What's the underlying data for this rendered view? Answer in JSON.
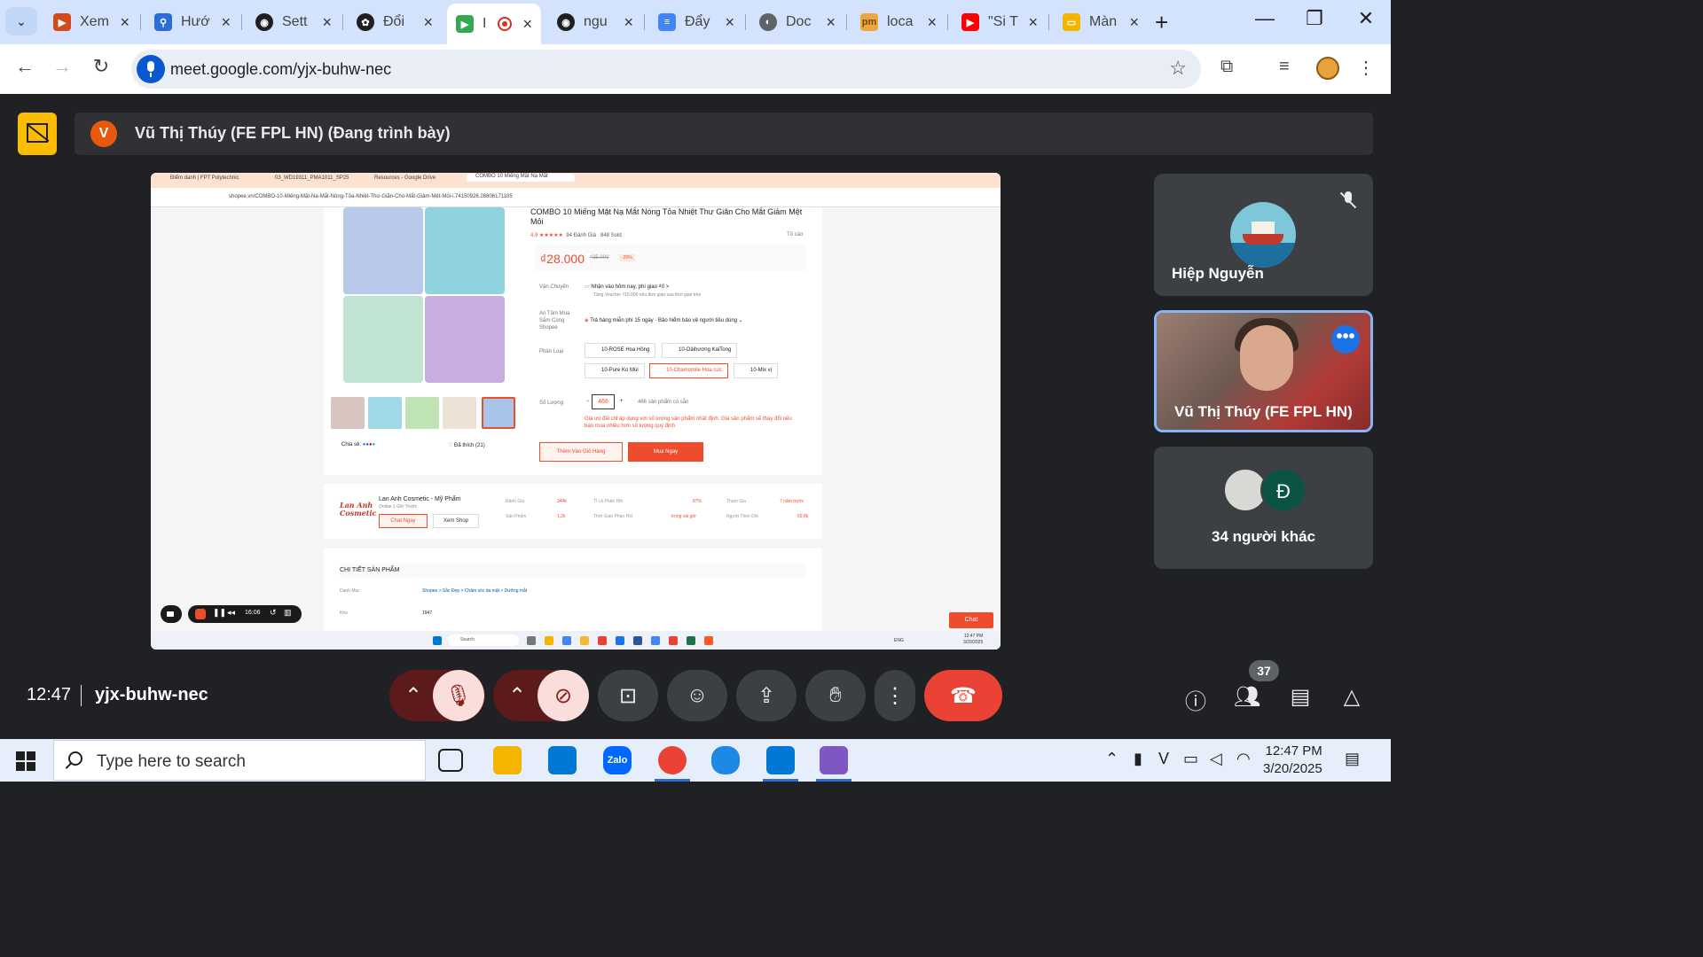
{
  "browser": {
    "tabs": [
      {
        "label": "Xem"
      },
      {
        "label": "Hướ"
      },
      {
        "label": "Sett"
      },
      {
        "label": "Đổi"
      },
      {
        "label": "I"
      },
      {
        "label": "ngu"
      },
      {
        "label": "Đẩy"
      },
      {
        "label": "Doc"
      },
      {
        "label": "loca"
      },
      {
        "label": "\"Si T"
      },
      {
        "label": "Màn"
      }
    ],
    "url": "meet.google.com/yjx-buhw-nec"
  },
  "meet": {
    "presenter_initial": "V",
    "presenter_banner": "Vũ Thị Thúy (FE FPL HN) (Đang trình bày)",
    "clock": "12:47",
    "meeting_code": "yjx-buhw-nec",
    "participants_count": "37",
    "tiles": {
      "t1_name": "Hiệp Nguyễn",
      "t2_name": "Vũ Thị Thúy (FE FPL HN)",
      "t3_name": "34 người khác",
      "t3_avatar_letter": "Đ"
    }
  },
  "shared": {
    "tabs": [
      "Điểm danh | FPT Polytechnic",
      "03_WD19311_PMA1011_SP25",
      "Resources - Google Drive",
      "COMBO 10 Miếng Mặt Nạ Mắt"
    ],
    "url": "shopee.vn/COMBO-10-Miếng-Mặt-Nạ-Mắt-Nóng-Tỏa-Nhiệt-Thư-Giãn-Cho-Mắt-Giảm-Mệt-Mỏi-i.74150926.28806171105",
    "product_title": "COMBO 10 Miếng Mặt Nạ Mắt Nóng Tỏa Nhiệt Thư Giãn Cho Mắt Giảm Mệt Mỏi",
    "rating": "4.9",
    "rating_count": "94",
    "rating_label": "Đánh Giá",
    "sold": "848",
    "sold_label": "Sold",
    "report": "Tố cáo",
    "price": "₫28.000",
    "old_price": "₫35.000",
    "discount": "-20%",
    "ship_label": "Vận Chuyển",
    "ship_value": "Nhận vào hôm nay, phí giao ₫0 >",
    "ship_sub": "Tặng Voucher ₫15.000 nếu đơn giao sau thời gian trên",
    "assure_label": "An Tâm Mua Sắm Cùng Shopee",
    "assure_value": "Trả hàng miễn phí 15 ngày · Bảo hiểm bảo vệ người tiêu dùng ⌄",
    "variant_label": "Phân Loại",
    "variants": [
      "10-ROSE Hoa Hồng",
      "10-Oảihương KaiTong",
      "10-Pure Ko Mùi",
      "10-Chamomile Hoa cúc",
      "10-Mix vị"
    ],
    "qty_label": "Số Lượng",
    "qty": "466",
    "stock": "466 sản phẩm có sẵn",
    "qty_warning": "Giá ưu đãi chỉ áp dụng với số lượng sản phẩm nhất định. Giá sản phẩm sẽ thay đổi nếu bạn mua nhiều hơn số lượng quy định",
    "add_to_cart": "Thêm Vào Giỏ Hàng",
    "buy_now": "Mua Ngay",
    "share_label": "Chia sẻ:",
    "liked": "Đã thích (21)",
    "shop_logo_1": "Lan Anh",
    "shop_logo_2": "Cosmetic",
    "shop_name": "Lan Anh Cosmetic - Mỹ Phẩm",
    "shop_online": "Online 1 Giờ Trước",
    "chat_now": "Chat Ngay",
    "view_shop": "Xem Shop",
    "stats": [
      {
        "label": "Đánh Giá",
        "value": "344k"
      },
      {
        "label": "Sản Phẩm",
        "value": "1,2k"
      },
      {
        "label": "Tỉ Lệ Phản Hồi",
        "value": "87%"
      },
      {
        "label": "Thời Gian Phản Hồi",
        "value": "trong vài giờ"
      },
      {
        "label": "Tham Gia",
        "value": "7 năm trước"
      },
      {
        "label": "Người Theo Dõi",
        "value": "69,8k"
      }
    ],
    "details_heading": "CHI TIẾT SẢN PHẨM",
    "category_label": "Danh Mục",
    "category_path": "Shopee > Sắc Đẹp > Chăm sóc da mặt > Dưỡng mắt",
    "stock_label": "Kho",
    "stock_value": "1947",
    "chat_button": "Chat",
    "rec_time": "16:06",
    "taskbar_search": "Search",
    "taskbar_time": "12:47 PM",
    "taskbar_date": "3/20/2025",
    "taskbar_lang": "ENG"
  },
  "taskbar": {
    "search_placeholder": "Type here to search",
    "time": "12:47 PM",
    "date": "3/20/2025"
  }
}
